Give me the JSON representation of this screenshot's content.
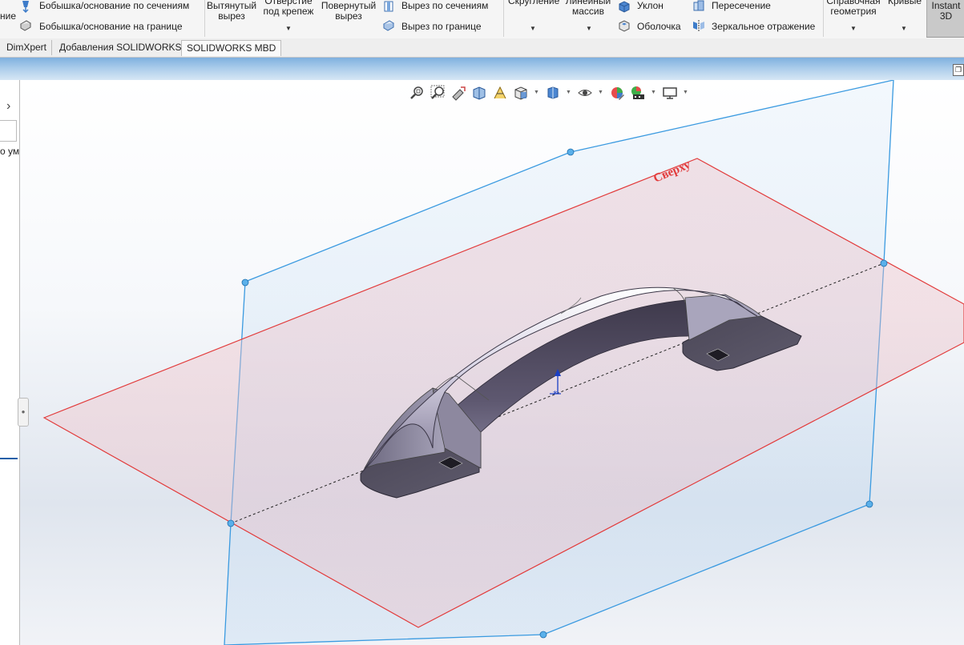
{
  "ribbon": {
    "cut_left": "ние",
    "loft_boss": "Бобышка/основание по сечениям",
    "boundary_boss": "Бобышка/основание на границе",
    "extruded_cut": [
      "Вытянутый",
      "вырез"
    ],
    "hole_wizard": [
      "Отверстие",
      "под крепеж"
    ],
    "revolved_cut": [
      "Повернутый",
      "вырез"
    ],
    "lofted_cut": "Вырез по сечениям",
    "boundary_cut": "Вырез по границе",
    "fillet": "Скругление",
    "linear_pattern": [
      "Линейный",
      "массив"
    ],
    "draft": "Уклон",
    "shell": "Оболочка",
    "intersect": "Пересечение",
    "mirror": "Зеркальное отражение",
    "ref_geometry": [
      "Справочная",
      "геометрия"
    ],
    "curves": "Кривые",
    "instant3d": [
      "Instant",
      "3D"
    ]
  },
  "tabs": [
    "DimXpert",
    "Добавления SOLIDWORKS",
    "SOLIDWORKS MBD"
  ],
  "left_panel": {
    "truncated_text": "о ум"
  },
  "viewport": {
    "plane_label": "Сверху"
  },
  "hud_icons": [
    "zoom-to-fit-icon",
    "zoom-to-area-icon",
    "previous-view-icon",
    "section-view-icon",
    "dynamic-annotation-icon",
    "view-orientation-icon",
    "display-style-icon",
    "hide-show-items-icon",
    "edit-appearance-icon",
    "apply-scene-icon",
    "view-settings-icon"
  ],
  "colors": {
    "front_plane": "#3a9ae0",
    "top_plane": "#e23a3a",
    "ribbon_bg": "#f5f5f5",
    "active_button": "#c9c9c9"
  }
}
